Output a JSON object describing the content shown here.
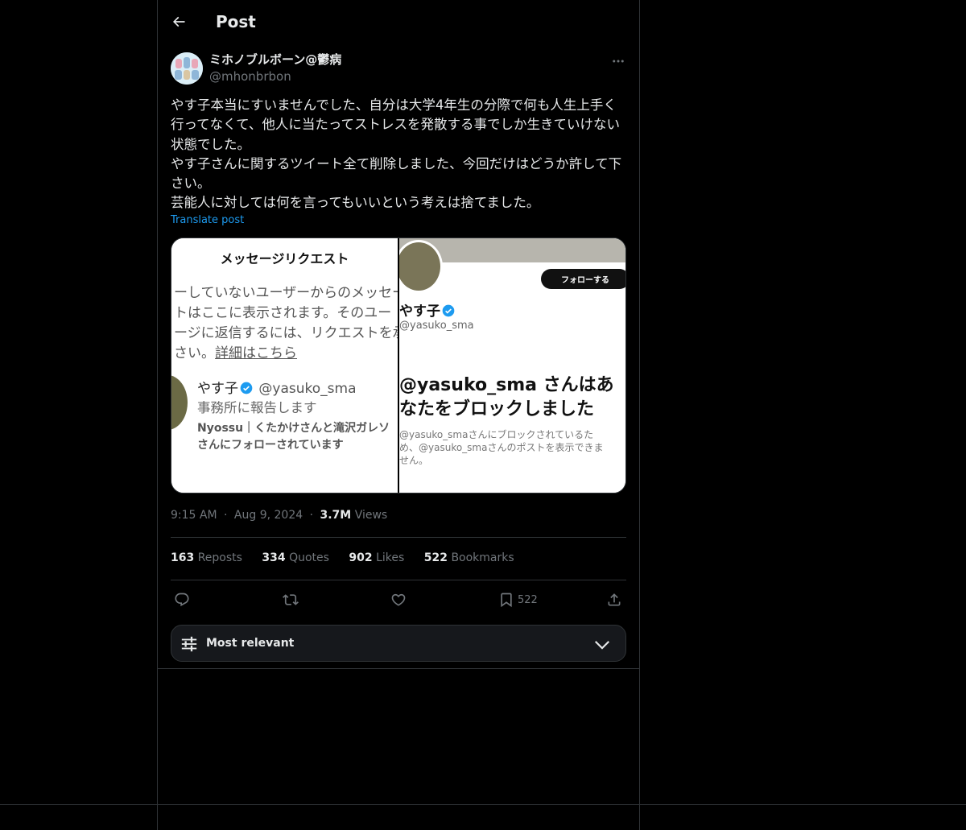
{
  "header": {
    "title": "Post"
  },
  "author": {
    "display_name": "ミホノブルボーン@鬱病",
    "handle": "@mhonbrbon"
  },
  "tweet": {
    "text": "やす子本当にすいませんでした、自分は大学4年生の分際で何も人生上手く行ってなくて、他人に当たってストレスを発散する事でしか生きていけない状態でした。\nやす子さんに関するツイート全て削除しました、今回だけはどうか許して下さい。\n芸能人に対しては何を言ってもいいという考えは捨てました。",
    "translate_label": "Translate post"
  },
  "media": {
    "left": {
      "title": "メッセージリクエスト",
      "desc_text": "ーしていないユーザーからのメッセー\nトはここに表示されます。そのユー\nージに返信するには、リクエストを承\nさい。",
      "desc_link": "詳細はこちら",
      "request_name": "やす子",
      "request_handle": "@yasuko_sma",
      "request_message": "事務所に報告します",
      "request_follow_prefix": "Nyossu｜",
      "request_follow_text": "くたかけさんと滝沢ガレソさんにフォローされています"
    },
    "right": {
      "follow_button": "フォローする",
      "name": "やす子",
      "handle": "@yasuko_sma",
      "blocked_title": "@yasuko_sma さんはあ\nなたをブロックしました",
      "blocked_sub": "@yasuko_smaさんにブロックされているた\nめ、@yasuko_smaさんのポストを表示できま\nせん。"
    }
  },
  "meta": {
    "time": "9:15 AM",
    "dot1": "·",
    "date": "Aug 9, 2024",
    "dot2": "·",
    "views_count": "3.7M",
    "views_label": "Views"
  },
  "stats": {
    "reposts_count": "163",
    "reposts_label": "Reposts",
    "quotes_count": "334",
    "quotes_label": "Quotes",
    "likes_count": "902",
    "likes_label": "Likes",
    "bookmarks_count": "522",
    "bookmarks_label": "Bookmarks"
  },
  "actions": {
    "bookmark_count": "522",
    "icons": [
      "reply-icon",
      "repost-icon",
      "like-icon",
      "bookmark-icon",
      "share-icon"
    ]
  },
  "sort": {
    "label": "Most relevant"
  },
  "colors": {
    "background": "#000000",
    "border": "#2f3336",
    "text_primary": "#e7e9ea",
    "text_secondary": "#71767b",
    "accent": "#1d9bf0"
  }
}
